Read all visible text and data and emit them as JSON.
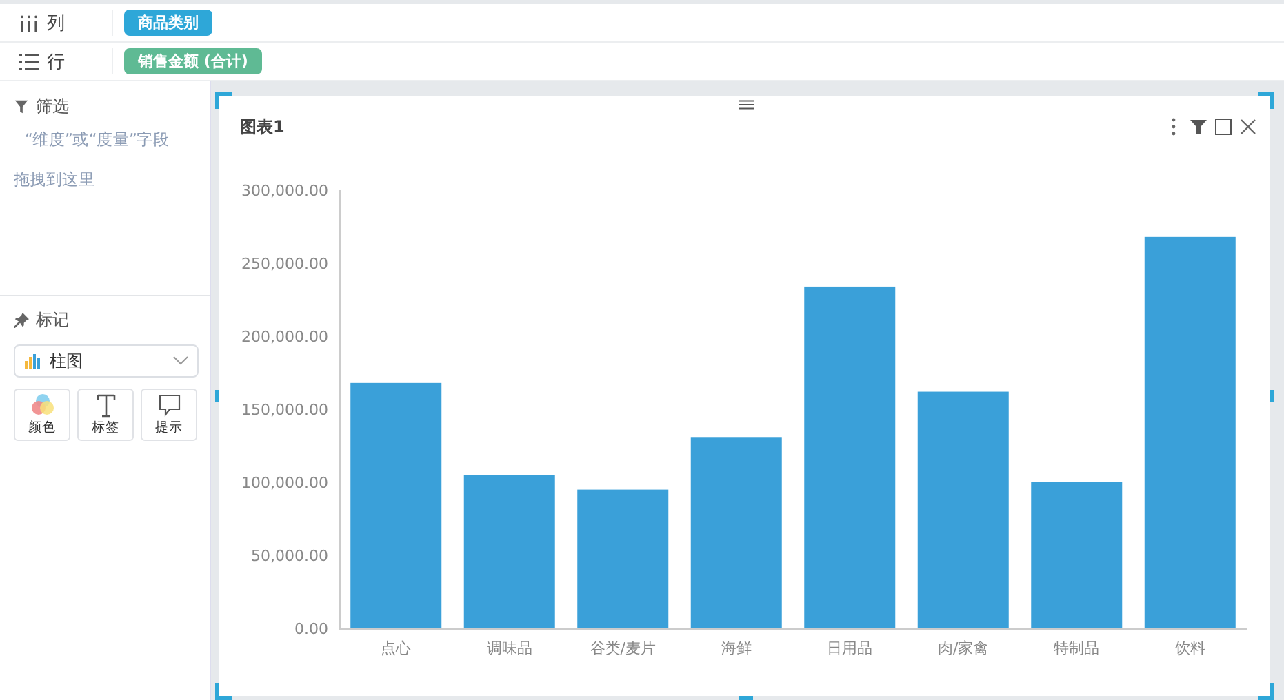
{
  "shelves": [
    {
      "kind": "columns",
      "label": "列",
      "pill": "商品类别",
      "color": "#2ea7d8"
    },
    {
      "kind": "rows",
      "label": "行",
      "pill": "销售金额 (合计)",
      "color": "#5fba94"
    }
  ],
  "filter": {
    "title": "筛选",
    "hint": "“维度”或“度量”字段",
    "hint2": "拖拽到这里"
  },
  "marks": {
    "title": "标记",
    "chart_type": "柱图",
    "buttons": [
      {
        "kind": "color",
        "label": "颜色"
      },
      {
        "kind": "text",
        "label": "标签"
      },
      {
        "kind": "tooltip",
        "label": "提示"
      }
    ]
  },
  "chart": {
    "title": "图表1",
    "chart_data": {
      "type": "bar",
      "categories": [
        "点心",
        "调味品",
        "谷类/麦片",
        "海鲜",
        "日用品",
        "肉/家禽",
        "特制品",
        "饮料"
      ],
      "series": [
        {
          "color": "#3aa0d9",
          "values": [
            168000,
            105000,
            95000,
            131000,
            234000,
            162000,
            100000,
            268000
          ]
        }
      ],
      "ylim": [
        0,
        300000
      ],
      "yticks": [
        {
          "value": 0,
          "label": "0.00"
        },
        {
          "value": 50000,
          "label": "50,000.00"
        },
        {
          "value": 100000,
          "label": "100,000.00"
        },
        {
          "value": 150000,
          "label": "150,000.00"
        },
        {
          "value": 200000,
          "label": "200,000.00"
        },
        {
          "value": 250000,
          "label": "250,000.00"
        },
        {
          "value": 300000,
          "label": "300,000.00"
        }
      ]
    }
  }
}
